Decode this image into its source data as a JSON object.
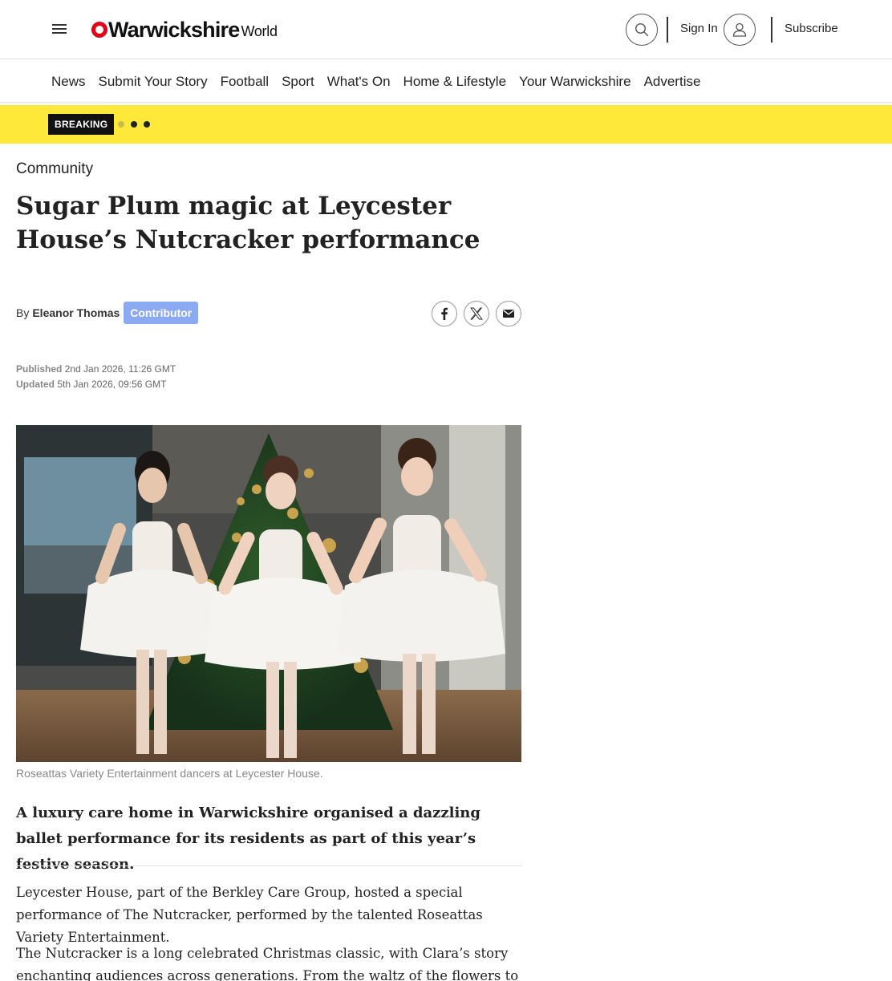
{
  "header": {
    "logo_main": "Warwickshire",
    "logo_sub": "World",
    "sign_in": "Sign In",
    "subscribe": "Subscribe"
  },
  "nav": {
    "items": [
      "News",
      "Submit Your Story",
      "Football",
      "Sport",
      "What's On",
      "Home & Lifestyle",
      "Your Warwickshire",
      "Advertise"
    ]
  },
  "breaking": {
    "label": "BREAKING"
  },
  "article": {
    "section": "Community",
    "headline": "Sugar Plum magic at Leycester House’s Nutcracker performance",
    "byline_prefix": "By",
    "author": "Eleanor Thomas",
    "author_role": "Contributor",
    "published_label": "Published",
    "published_value": "2nd Jan 2026, 11:26 GMT",
    "updated_label": "Updated",
    "updated_value": "5th Jan 2026, 09:56 GMT",
    "image_caption": "Roseattas Variety Entertainment dancers at Leycester House.",
    "standfirst": "A luxury care home in Warwickshire organised a dazzling ballet performance for its residents as part of this year’s festive season.",
    "paragraphs": [
      "Leycester House, part of the Berkley Care Group, hosted a special performance of The Nutcracker, performed by the talented Roseattas Variety Entertainment.",
      "The Nutcracker is a long celebrated Christmas classic, with Clara’s story enchanting audiences across generations. From the waltz of the flowers to the"
    ]
  },
  "icons": {
    "menu": "hamburger-menu-icon",
    "search": "search-icon",
    "user": "user-icon",
    "share": [
      "facebook-icon",
      "x-icon",
      "email-icon"
    ]
  },
  "colors": {
    "brand_red": "#e2001a",
    "breaking_bg": "#fee83a",
    "contributor_badge": "#8caaf3"
  }
}
